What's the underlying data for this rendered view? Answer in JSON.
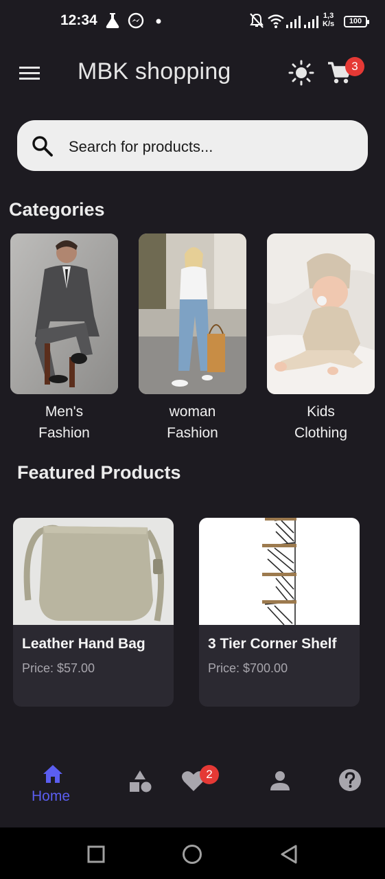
{
  "status_bar": {
    "time": "12:34",
    "speed_value": "1,3",
    "speed_unit": "K/s",
    "battery": "100",
    "icons": [
      "flask-icon",
      "messenger-icon",
      "dot-icon",
      "bell-off-icon",
      "wifi-icon",
      "signal-icon",
      "signal-icon"
    ]
  },
  "app_bar": {
    "title": "MBK shopping",
    "cart_count": "3",
    "icons": [
      "menu-icon",
      "sun-icon",
      "cart-icon"
    ]
  },
  "search": {
    "placeholder": "Search for products..."
  },
  "categories": {
    "title": "Categories",
    "items": [
      {
        "label": "Men's\nFashion"
      },
      {
        "label": "woman\nFashion"
      },
      {
        "label": "Kids\nClothing"
      }
    ]
  },
  "featured": {
    "title": "Featured Products",
    "products": [
      {
        "name": "Leather Hand Bag",
        "price": "Price: $57.00"
      },
      {
        "name": "3 Tier Corner Shelf",
        "price": "Price: $700.00"
      }
    ]
  },
  "bottom_nav": {
    "home_label": "Home",
    "favorites_count": "2",
    "active_color": "#5b5ef0",
    "icons": [
      "home-icon",
      "categories-icon",
      "heart-icon",
      "person-icon",
      "help-icon"
    ]
  },
  "colors": {
    "background": "#1d1b21",
    "card": "#2b2931",
    "badge": "#e53935",
    "accent": "#5b5ef0"
  }
}
